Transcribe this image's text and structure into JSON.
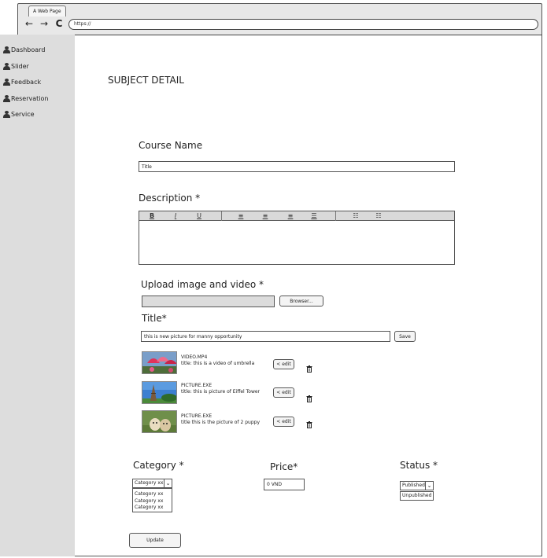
{
  "browser": {
    "tab_title": "A Web Page",
    "url": "https://",
    "back_glyph": "←",
    "forward_glyph": "→",
    "reload_glyph": "C"
  },
  "sidebar": {
    "items": [
      {
        "label": "Dashboard",
        "icon": "person-icon"
      },
      {
        "label": "Slider",
        "icon": "person-icon"
      },
      {
        "label": "Feedback",
        "icon": "person-icon"
      },
      {
        "label": "Reservation",
        "icon": "person-icon"
      },
      {
        "label": "Service",
        "icon": "person-icon"
      }
    ]
  },
  "page": {
    "title": "SUBJECT DETAIL"
  },
  "course": {
    "label": "Course Name",
    "value": "Title"
  },
  "description": {
    "label": "Description *",
    "toolbar": [
      "B",
      "I",
      "U",
      "≡",
      "≡",
      "≡",
      "☰",
      "☷",
      "☷"
    ]
  },
  "upload": {
    "label": "Upload image and video *",
    "browse_label": "Browser..."
  },
  "media_title": {
    "label": "Title*",
    "value": "this is new picture for manny opportunity",
    "save_label": "Save"
  },
  "media": [
    {
      "name": "VIDEO.MP4",
      "title": "title: this is a video of umbrella",
      "edit_label": "< edit",
      "thumb": "umbrella"
    },
    {
      "name": "PICTURE.EXE",
      "title": "title: this is picture of Eiffel Tower",
      "edit_label": "< edit",
      "thumb": "eiffel"
    },
    {
      "name": "PICTURE.EXE",
      "title": "title this is the picture of 2 puppy",
      "edit_label": "< edit",
      "thumb": "puppy"
    }
  ],
  "category": {
    "label": "Category *",
    "selected": "Category xx",
    "options": [
      "Category xx",
      "Category xx",
      "Category xx"
    ]
  },
  "price": {
    "label": "Price*",
    "value": "0 VND"
  },
  "status": {
    "label": "Status *",
    "selected": "Published",
    "options": [
      "Unpublished"
    ]
  },
  "update_label": "Update"
}
